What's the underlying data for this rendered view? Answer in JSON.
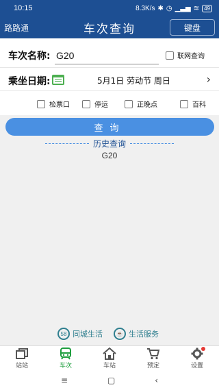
{
  "status_bar": {
    "time": "10:15",
    "net_speed": "8.3K/s",
    "battery": "49"
  },
  "header": {
    "brand": "路路通",
    "title": "车次查询",
    "keyboard_button": "键盘"
  },
  "form": {
    "train_label": "车次名称:",
    "train_value": "G20",
    "online_query_label": "联网查询",
    "online_query_checked": false,
    "date_label": "乘坐日期:",
    "date_value": "5月1日  劳动节  周日",
    "options": [
      {
        "label": "检票口",
        "checked": false
      },
      {
        "label": "停运",
        "checked": false
      },
      {
        "label": "正晚点",
        "checked": false
      },
      {
        "label": "百科",
        "checked": false
      }
    ]
  },
  "search_button": "查询",
  "history": {
    "title": "历史查询",
    "items": [
      "G20"
    ]
  },
  "footer_links": [
    {
      "icon_text": "58",
      "label": "同城生活"
    },
    {
      "icon_text": "",
      "label": "生活服务"
    }
  ],
  "tabs": [
    {
      "label": "站站",
      "icon": "station-to-station-icon",
      "active": false
    },
    {
      "label": "车次",
      "icon": "train-icon",
      "active": true
    },
    {
      "label": "车站",
      "icon": "station-house-icon",
      "active": false
    },
    {
      "label": "预定",
      "icon": "cart-icon",
      "active": false
    },
    {
      "label": "设置",
      "icon": "gear-icon",
      "active": false
    }
  ],
  "colors": {
    "header": "#1d4f93",
    "accent": "#4a90e2",
    "active_tab": "#1e9e3e",
    "link": "#2f7f8f"
  }
}
